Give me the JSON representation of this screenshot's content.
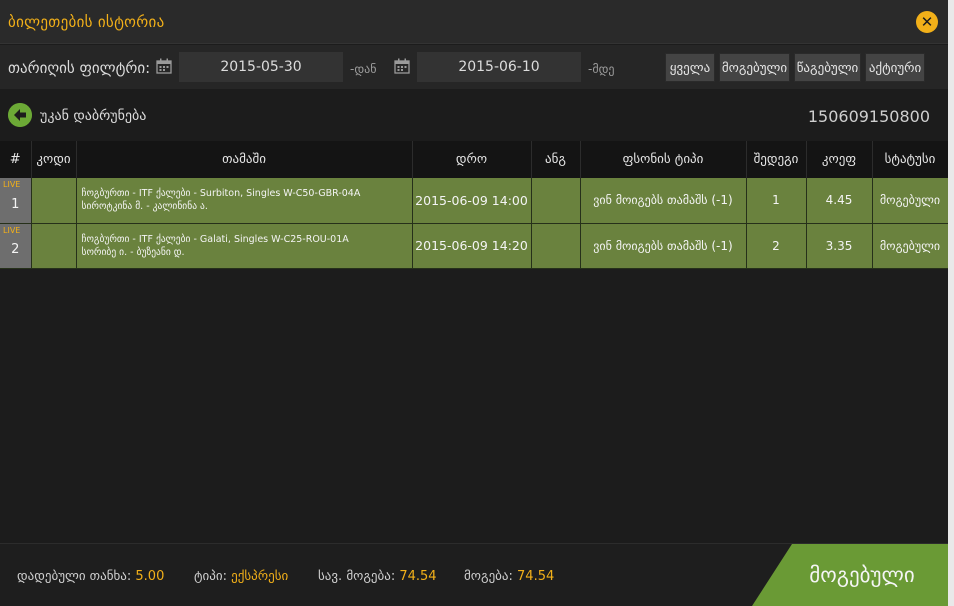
{
  "title": "ბილეთების ისტორია",
  "filter": {
    "label": "თარიღის ფილტრი:",
    "from_date": "2015-05-30",
    "from_suffix": "-დან",
    "to_date": "2015-06-10",
    "to_suffix": "-მდე",
    "buttons": [
      "ყველა",
      "მოგებული",
      "წაგებული",
      "აქტიური"
    ]
  },
  "back": {
    "label": "უკან დაბრუნება"
  },
  "ticket_id": "150609150800",
  "table": {
    "headers": [
      "#",
      "კოდი",
      "თამაში",
      "დრო",
      "ანგ",
      "ფსონის ტიპი",
      "შედეგი",
      "კოეფ",
      "სტატუსი"
    ],
    "rows": [
      {
        "num": "1",
        "live": "LIVE",
        "code": "",
        "game_line1": "ჩოგბურთი - ITF ქალები - Surbiton, Singles W-C50-GBR-04A",
        "game_line2": "სიროტკინა მ. - კალინინა ა.",
        "time": "2015-06-09 14:00",
        "ang": "",
        "bet_type": "ვინ მოიგებს თამაშს (-1)",
        "result": "1",
        "coef": "4.45",
        "status": "მოგებული"
      },
      {
        "num": "2",
        "live": "LIVE",
        "code": "",
        "game_line1": "ჩოგბურთი - ITF ქალები - Galati, Singles W-C25-ROU-01A",
        "game_line2": "სორიბე ი. - ბუზეანი დ.",
        "time": "2015-06-09 14:20",
        "ang": "",
        "bet_type": "ვინ მოიგებს თამაშს (-1)",
        "result": "2",
        "coef": "3.35",
        "status": "მოგებული"
      }
    ]
  },
  "footer": {
    "stake_label": "დადებული თანხა:",
    "stake_value": "5.00",
    "type_label": "ტიპი:",
    "type_value": "ექსპრესი",
    "potential_label": "სავ. მოგება:",
    "potential_value": "74.54",
    "win_label": "მოგება:",
    "win_value": "74.54",
    "result_button": "მოგებული"
  },
  "colors": {
    "accent": "#f2b019",
    "row_green": "#6a823e",
    "result_green": "#6a9a35",
    "back_icon_green": "#6ca936"
  },
  "icons": [
    "close-icon",
    "calendar-icon",
    "back-arrow-icon"
  ]
}
